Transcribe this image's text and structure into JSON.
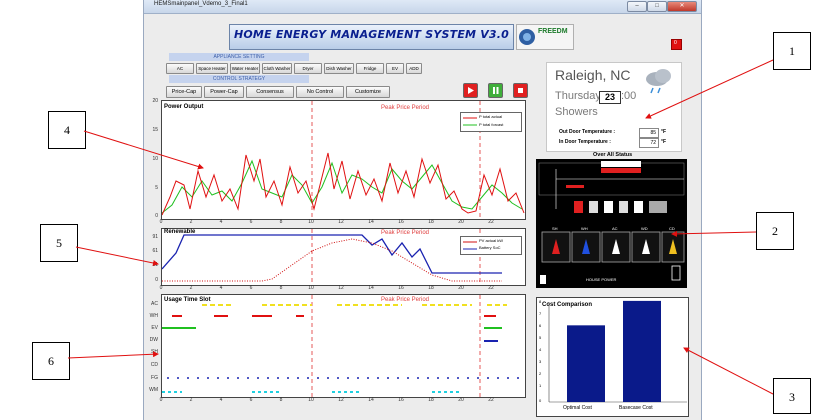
{
  "window": {
    "title": "HEMSmainpanel_Vdemo_3_Final1",
    "min": "–",
    "max": "□",
    "close": "✕"
  },
  "header": {
    "title": "HOME ENERGY MANAGEMENT SYSTEM V3.0",
    "logo_text": "FREEDM",
    "stop_label": "0"
  },
  "appliance_setting": {
    "label": "APPLIANCE SETTING",
    "buttons": [
      "AC",
      "Space Heater",
      "Water Heater",
      "Cloth Washer",
      "Dryer",
      "Dish Washer",
      "Fridge",
      "EV",
      "ADD"
    ]
  },
  "control_strategy": {
    "label": "CONTROL STRATEGY",
    "buttons": [
      "Price-Cap",
      "Power-Cap",
      "Consensus",
      "No Control",
      "Customize"
    ]
  },
  "weather": {
    "city": "Raleigh, NC",
    "day": "Thursday",
    "date": "23",
    "time_suffix": ":00",
    "condition": "Showers",
    "outdoor_label": "Out Door Temperature :",
    "outdoor_value": "85",
    "outdoor_unit": "°F",
    "indoor_label": "In Door Temperature :",
    "indoor_value": "72",
    "indoor_unit": "°F"
  },
  "status": {
    "title": "Over All Status",
    "appliance_labels": [
      "SH",
      "WH",
      "AC",
      "WD",
      "CD"
    ],
    "footer": "HOUSE POWER"
  },
  "plots": {
    "peak_label": "Peak Price Period",
    "x_ticks": [
      "0",
      "2",
      "4",
      "6",
      "8",
      "10",
      "12",
      "14",
      "16",
      "18",
      "20",
      "22"
    ],
    "power": {
      "title": "Power Output",
      "y_ticks": [
        "20",
        "15",
        "10",
        "5",
        "0"
      ],
      "legend": [
        "P total actual",
        "P total forcast"
      ]
    },
    "renewable": {
      "title": "Renewable",
      "y_ticks": [
        "91",
        "61",
        "31",
        "0"
      ],
      "legend": [
        "PV actual kW",
        "Battery SoC"
      ]
    },
    "usage": {
      "title": "Usage Time Slot",
      "rows": [
        "AC",
        "WH",
        "EV",
        "DW",
        "SH",
        "CD",
        "FG",
        "WM"
      ]
    }
  },
  "cost": {
    "title": "Cost Comparison",
    "y_ticks": [
      "8",
      "7",
      "6",
      "5",
      "4",
      "3",
      "2",
      "1",
      "0"
    ],
    "categories": [
      "Optimal Cost",
      "Basecase Cost"
    ]
  },
  "callouts": [
    "1",
    "2",
    "3",
    "4",
    "5",
    "6"
  ],
  "chart_data": [
    {
      "type": "bar",
      "title": "Cost Comparison",
      "categories": [
        "Optimal Cost",
        "Basecase Cost"
      ],
      "values": [
        6.9,
        9.1
      ],
      "ylim": [
        0,
        9
      ]
    },
    {
      "type": "line",
      "title": "Renewable",
      "x": [
        0,
        2,
        4,
        6,
        8,
        10,
        12,
        14,
        16,
        18,
        20,
        22
      ],
      "series": [
        {
          "name": "PV actual kW",
          "values": [
            0,
            0,
            0,
            0,
            0,
            25,
            70,
            91,
            80,
            45,
            5,
            0
          ]
        },
        {
          "name": "Battery SoC",
          "values": [
            30,
            91,
            91,
            91,
            91,
            91,
            91,
            80,
            55,
            40,
            10,
            10
          ]
        }
      ]
    }
  ]
}
